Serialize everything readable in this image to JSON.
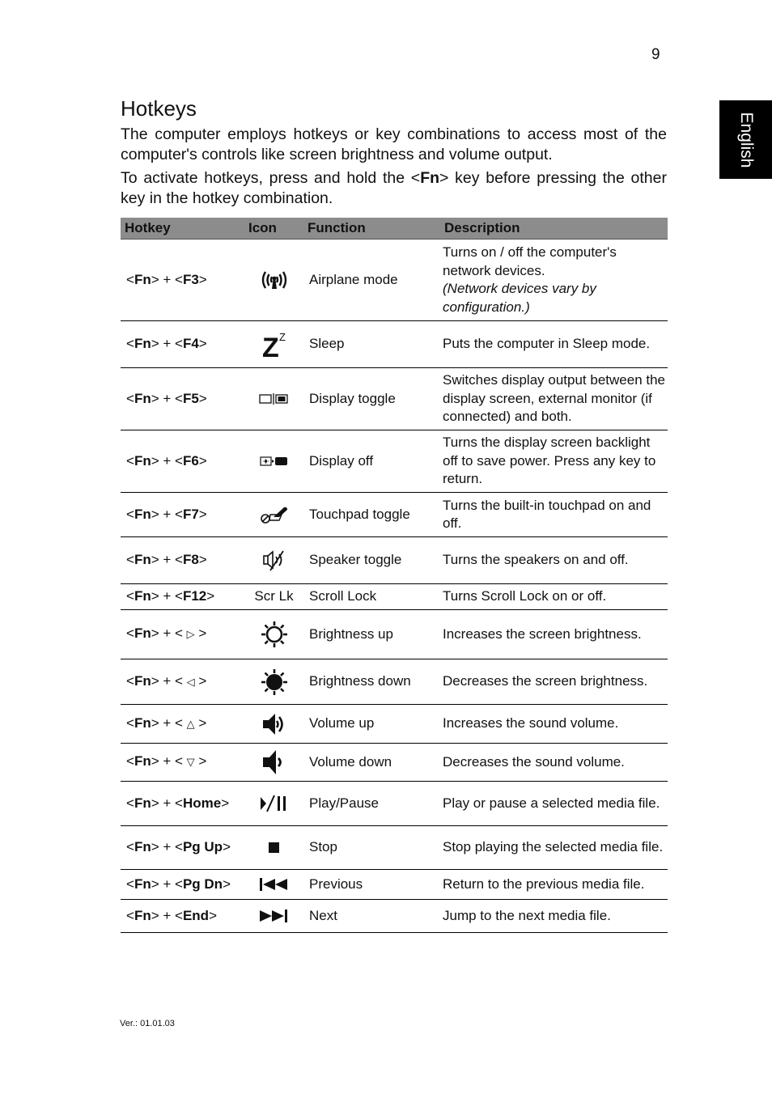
{
  "page_number": "9",
  "language_tab": "English",
  "title": "Hotkeys",
  "intro": "The computer employs hotkeys or key combinations to access most of the computer's controls like screen brightness and volume output.",
  "activate": {
    "pre": "To activate hotkeys, press and hold the <",
    "key": "Fn",
    "post": "> key before pressing the other key in the hotkey combination."
  },
  "table": {
    "headers": [
      "Hotkey",
      "Icon",
      "Function",
      "Description"
    ],
    "rows": [
      {
        "key": "F3",
        "icon": "airplane-mode-icon",
        "function": "Airplane mode",
        "description": "Turns on / off the computer's network devices.",
        "note": "(Network devices vary by configuration.)"
      },
      {
        "key": "F4",
        "icon": "sleep-icon",
        "function": "Sleep",
        "description": "Puts the computer in Sleep mode."
      },
      {
        "key": "F5",
        "icon": "display-toggle-icon",
        "function": "Display toggle",
        "description": "Switches display output between the display screen, external monitor (if connected) and both."
      },
      {
        "key": "F6",
        "icon": "display-off-icon",
        "function": "Display off",
        "description": "Turns the display screen backlight off to save power. Press any key to return."
      },
      {
        "key": "F7",
        "icon": "touchpad-toggle-icon",
        "function": "Touchpad toggle",
        "description": "Turns the built-in touchpad on and off."
      },
      {
        "key": "F8",
        "icon": "speaker-toggle-icon",
        "function": "Speaker toggle",
        "description": "Turns the speakers on and off."
      },
      {
        "key": "F12",
        "icon_text": "Scr Lk",
        "icon": "scroll-lock-text",
        "function": "Scroll Lock",
        "description": "Turns Scroll Lock on or off."
      },
      {
        "key": "▷",
        "key_symbol": true,
        "icon": "brightness-up-icon",
        "function": "Brightness up",
        "description": "Increases the screen brightness."
      },
      {
        "key": "◁",
        "key_symbol": true,
        "icon": "brightness-down-icon",
        "function": "Brightness down",
        "description": "Decreases the screen brightness."
      },
      {
        "key": "△",
        "key_symbol": true,
        "icon": "volume-up-icon",
        "function": "Volume up",
        "description": "Increases the sound volume."
      },
      {
        "key": "▽",
        "key_symbol": true,
        "icon": "volume-down-icon",
        "function": "Volume down",
        "description": "Decreases the sound volume."
      },
      {
        "key": "Home",
        "icon": "play-pause-icon",
        "function": "Play/Pause",
        "description": "Play or pause a selected media file."
      },
      {
        "key": "Pg Up",
        "icon": "stop-icon",
        "function": "Stop",
        "description": "Stop playing the selected media file."
      },
      {
        "key": "Pg Dn",
        "icon": "previous-icon",
        "function": "Previous",
        "description": "Return to the previous media file."
      },
      {
        "key": "End",
        "icon": "next-icon",
        "function": "Next",
        "description": "Jump to the next media file."
      }
    ],
    "fn_label": "Fn"
  },
  "version": "Ver.: 01.01.03"
}
